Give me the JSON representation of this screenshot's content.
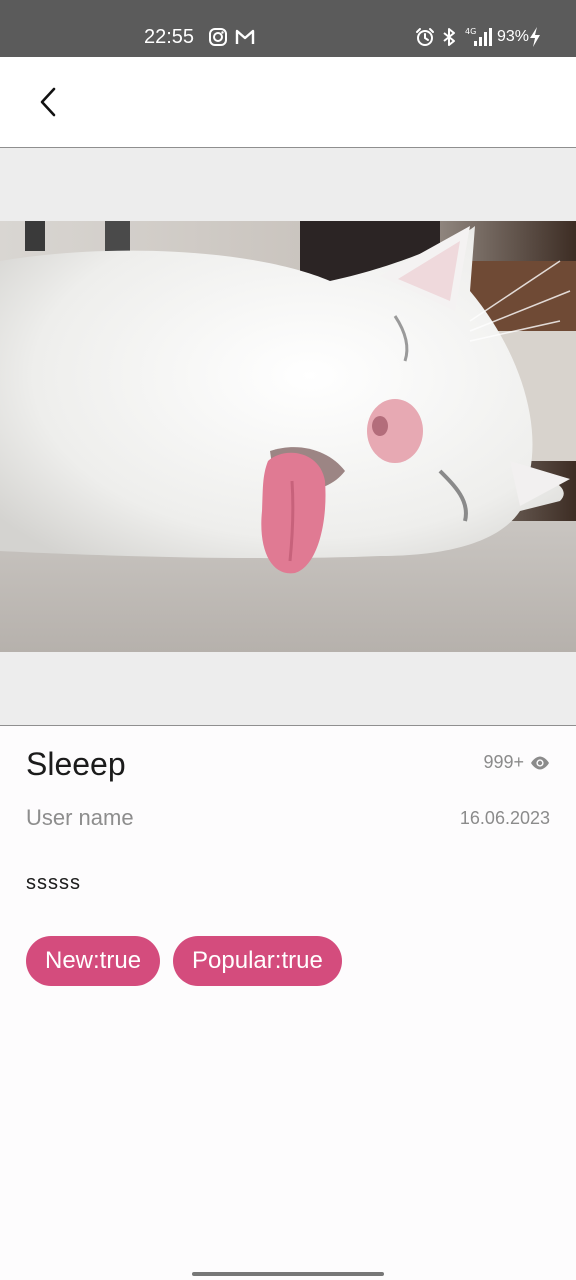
{
  "status_bar": {
    "time": "22:55",
    "battery": "93%",
    "icons": [
      "instagram-icon",
      "gmail-icon",
      "alarm-icon",
      "bluetooth-icon",
      "signal-4g-icon",
      "charging-icon"
    ]
  },
  "app_bar": {
    "back_icon": "chevron-left-icon"
  },
  "photo": {
    "subject": "sleeping white cat with tongue out"
  },
  "post": {
    "title": "Sleeep",
    "views": "999+",
    "user_name": "User name",
    "date": "16.06.2023",
    "description": "sssss",
    "tags": [
      {
        "label": "New:true"
      },
      {
        "label": "Popular:true"
      }
    ]
  },
  "colors": {
    "status_bar": "#5b5b5b",
    "chip": "#d44c7d",
    "secondary_text": "#8b8b8b",
    "divider": "#8f8f8f"
  }
}
